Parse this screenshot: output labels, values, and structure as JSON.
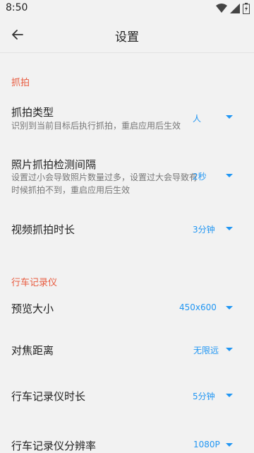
{
  "status": {
    "time": "8:50"
  },
  "header": {
    "title": "设置"
  },
  "sections": {
    "capture": {
      "title": "抓拍",
      "capture_type": {
        "title": "抓拍类型",
        "desc": "识别到当前目标后执行抓拍，重启应用后生效",
        "value": "人"
      },
      "photo_interval": {
        "title": "照片抓拍检测间隔",
        "desc": "设置过小会导致照片数量过多，设置过大会导致有时候抓拍不到，重启应用后生效",
        "value": "2秒"
      },
      "video_duration": {
        "title": "视频抓拍时长",
        "value": "3分钟"
      }
    },
    "dashcam": {
      "title": "行车记录仪",
      "preview_size": {
        "title": "预览大小",
        "value": "450x600"
      },
      "focus_distance": {
        "title": "对焦距离",
        "value": "无限远"
      },
      "record_duration": {
        "title": "行车记录仪时长",
        "value": "5分钟"
      },
      "resolution": {
        "title": "行车记录仪分辨率",
        "value": "1080P"
      }
    }
  },
  "colors": {
    "accent": "#2196f3",
    "section": "#e85b3f",
    "background": "#f2f2f2"
  },
  "icons": [
    "wifi-icon",
    "signal-icon",
    "battery-icon",
    "back-arrow-icon",
    "dropdown-caret-icon"
  ]
}
